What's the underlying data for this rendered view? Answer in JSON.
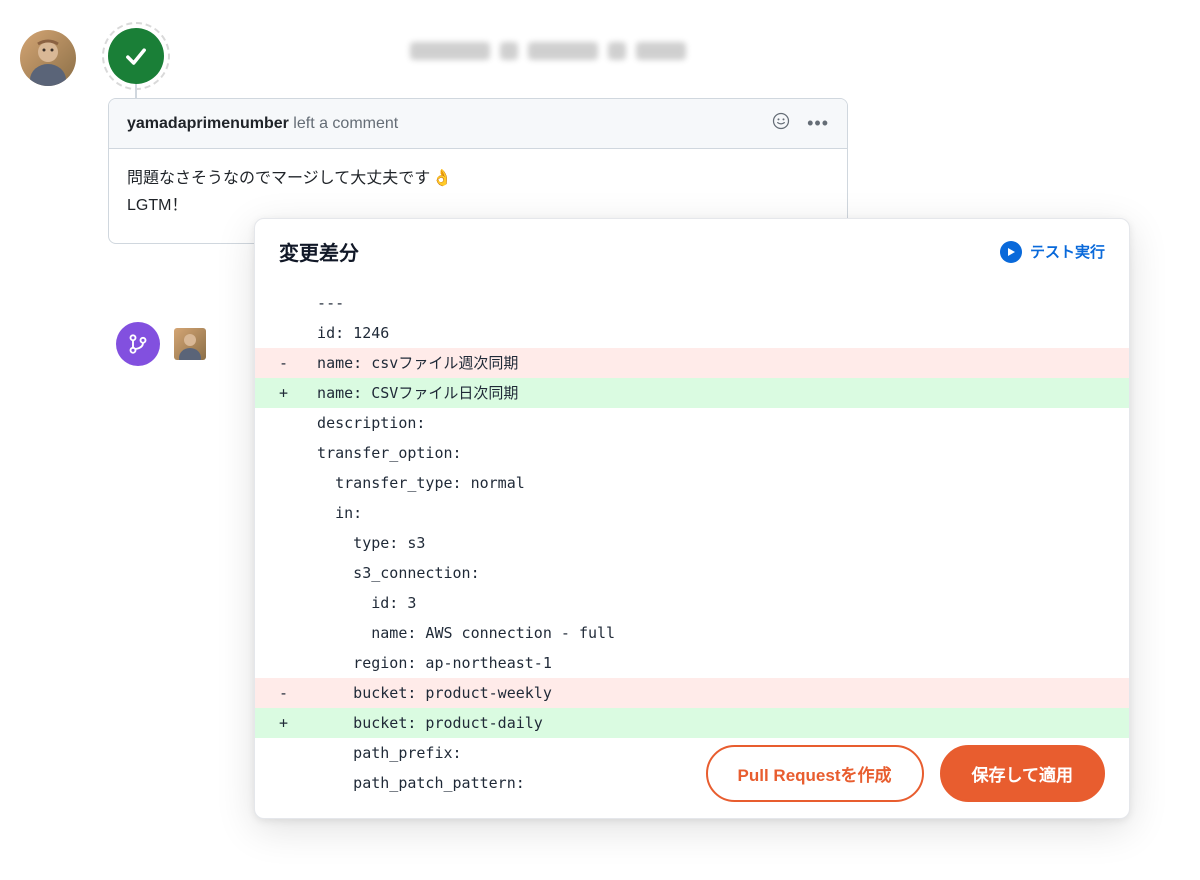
{
  "comment": {
    "author": "yamadaprimenumber",
    "action": "left a comment",
    "body_line1": "問題なさそうなのでマージして大丈夫です",
    "emoji": "👌",
    "body_line2": "LGTM！"
  },
  "diff": {
    "title": "変更差分",
    "run_test_label": "テスト実行",
    "lines": [
      {
        "type": "ctx",
        "sign": " ",
        "text": "  ---"
      },
      {
        "type": "ctx",
        "sign": " ",
        "text": "  id: 1246"
      },
      {
        "type": "del",
        "sign": "-",
        "text": "  name: csvファイル週次同期"
      },
      {
        "type": "add",
        "sign": "+",
        "text": "  name: CSVファイル日次同期"
      },
      {
        "type": "ctx",
        "sign": " ",
        "text": "  description:"
      },
      {
        "type": "ctx",
        "sign": " ",
        "text": "  transfer_option:"
      },
      {
        "type": "ctx",
        "sign": " ",
        "text": "    transfer_type: normal"
      },
      {
        "type": "ctx",
        "sign": " ",
        "text": "    in:"
      },
      {
        "type": "ctx",
        "sign": " ",
        "text": "      type: s3"
      },
      {
        "type": "ctx",
        "sign": " ",
        "text": "      s3_connection:"
      },
      {
        "type": "ctx",
        "sign": " ",
        "text": "        id: 3"
      },
      {
        "type": "ctx",
        "sign": " ",
        "text": "        name: AWS connection - full"
      },
      {
        "type": "ctx",
        "sign": " ",
        "text": "      region: ap-northeast-1"
      },
      {
        "type": "del",
        "sign": "-",
        "text": "      bucket: product-weekly"
      },
      {
        "type": "add",
        "sign": "+",
        "text": "      bucket: product-daily"
      },
      {
        "type": "ctx",
        "sign": " ",
        "text": "      path_prefix:"
      },
      {
        "type": "ctx",
        "sign": " ",
        "text": "      path_patch_pattern:"
      }
    ]
  },
  "actions": {
    "create_pr": "Pull Requestを作成",
    "save_apply": "保存して適用"
  }
}
